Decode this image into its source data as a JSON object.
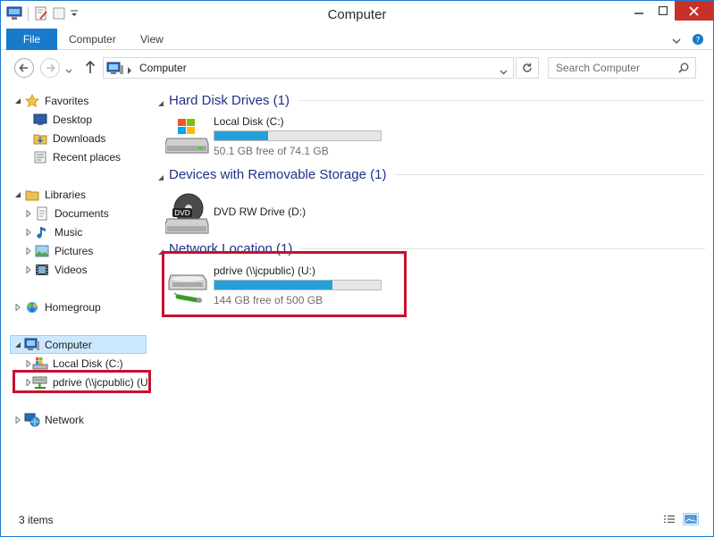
{
  "window": {
    "title": "Computer"
  },
  "ribbon": {
    "tabs": [
      "File",
      "Computer",
      "View"
    ]
  },
  "address": {
    "crumb": "Computer"
  },
  "search": {
    "placeholder": "Search Computer"
  },
  "navpane": {
    "favorites": {
      "label": "Favorites",
      "items": [
        "Desktop",
        "Downloads",
        "Recent places"
      ]
    },
    "libraries": {
      "label": "Libraries",
      "items": [
        "Documents",
        "Music",
        "Pictures",
        "Videos"
      ]
    },
    "homegroup": "Homegroup",
    "computer": {
      "label": "Computer",
      "items": [
        "Local Disk (C:)",
        "pdrive (\\\\jcpublic) (U:)"
      ]
    },
    "network": "Network"
  },
  "content": {
    "groups": [
      {
        "title": "Hard Disk Drives (1)"
      },
      {
        "title": "Devices with Removable Storage (1)"
      },
      {
        "title": "Network Location (1)"
      }
    ],
    "drives": [
      {
        "name": "Local Disk (C:)",
        "free_text": "50.1 GB free of 74.1 GB",
        "used_fraction": 0.324
      },
      {
        "name": "DVD RW Drive (D:)",
        "icon_badge": "DVD"
      },
      {
        "name": "pdrive (\\\\jcpublic) (U:)",
        "free_text": "144 GB free of 500 GB",
        "used_fraction": 0.712
      }
    ]
  },
  "status": {
    "count": "3 items"
  },
  "colors": {
    "accent": "#1979ca",
    "close": "#c7312a",
    "progress": "#26a0da",
    "highlight": "#c8102e",
    "selection": "#cce8ff"
  }
}
